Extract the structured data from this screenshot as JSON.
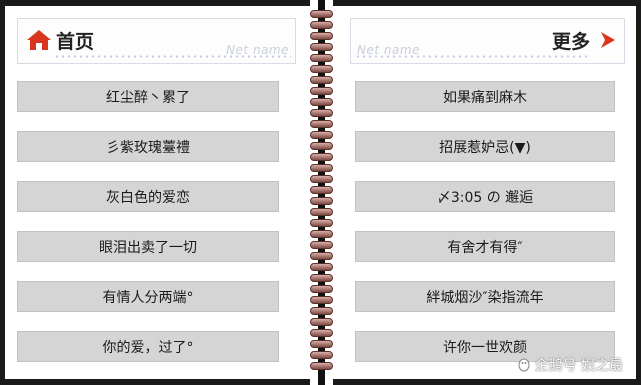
{
  "left_page": {
    "title": "首页",
    "net_name": "Net name",
    "items": [
      "红尘醉丶累了",
      "彡紫玫瑰薹禮",
      "灰白色的爱恋",
      "眼泪出卖了一切",
      "有情人分两端°",
      "你的爱，过了°"
    ]
  },
  "right_page": {
    "title": "更多",
    "net_name": "Net name",
    "items": [
      "如果痛到麻木",
      "招展惹妒忌(▼)",
      "〆3:05 の 邂逅",
      "有舍才有得″",
      "絆城烟沙″染指流年",
      "许你一世欢颜"
    ]
  },
  "watermark": {
    "text": "企鹅号 娱之最"
  },
  "colors": {
    "frame": "#1a1a1a",
    "item_bg": "#d5d5d5",
    "accent_red": "#d9361f",
    "ring": "#9c615a"
  },
  "icons": {
    "home": "home-icon",
    "more": "chevron-right-icon",
    "logo": "penguin-logo-icon"
  }
}
